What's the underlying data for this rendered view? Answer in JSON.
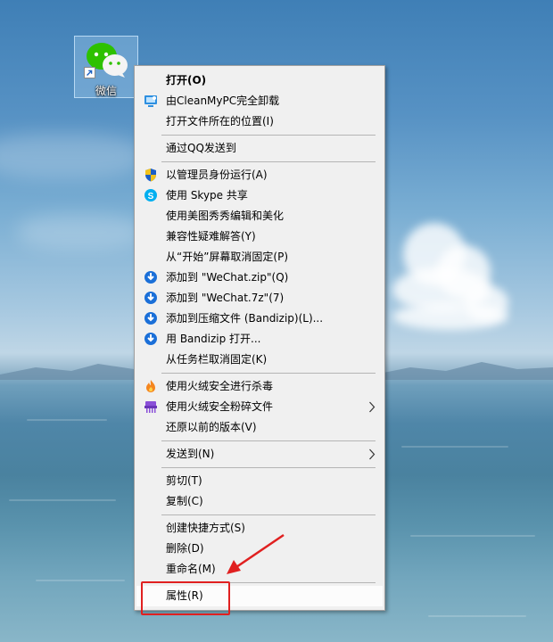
{
  "desktop": {
    "icon": {
      "label": "微信",
      "icon_name": "wechat-icon"
    }
  },
  "menu": {
    "items": [
      {
        "label": "打开(O)",
        "icon": "",
        "bold": true
      },
      {
        "label": "由CleanMyPC完全卸载",
        "icon": "cleanmypc-icon"
      },
      {
        "label": "打开文件所在的位置(I)",
        "icon": ""
      },
      {
        "label": "通过QQ发送到",
        "icon": ""
      },
      {
        "label": "以管理员身份运行(A)",
        "icon": "uac-shield-icon"
      },
      {
        "label": "使用 Skype 共享",
        "icon": "skype-icon"
      },
      {
        "label": "使用美图秀秀编辑和美化",
        "icon": ""
      },
      {
        "label": "兼容性疑难解答(Y)",
        "icon": ""
      },
      {
        "label": "从“开始”屏幕取消固定(P)",
        "icon": ""
      },
      {
        "label": "添加到 \"WeChat.zip\"(Q)",
        "icon": "bandizip-icon"
      },
      {
        "label": "添加到 \"WeChat.7z\"(7)",
        "icon": "bandizip-icon"
      },
      {
        "label": "添加到压缩文件 (Bandizip)(L)...",
        "icon": "bandizip-icon"
      },
      {
        "label": "用 Bandizip 打开...",
        "icon": "bandizip-icon"
      },
      {
        "label": "从任务栏取消固定(K)",
        "icon": ""
      },
      {
        "label": "使用火绒安全进行杀毒",
        "icon": "huorong-flame-icon"
      },
      {
        "label": "使用火绒安全粉碎文件",
        "icon": "huorong-shredder-icon",
        "submenu": true
      },
      {
        "label": "还原以前的版本(V)",
        "icon": ""
      },
      {
        "label": "发送到(N)",
        "icon": "",
        "submenu": true
      },
      {
        "label": "剪切(T)",
        "icon": ""
      },
      {
        "label": "复制(C)",
        "icon": ""
      },
      {
        "label": "创建快捷方式(S)",
        "icon": ""
      },
      {
        "label": "删除(D)",
        "icon": ""
      },
      {
        "label": "重命名(M)",
        "icon": ""
      },
      {
        "label": "属性(R)",
        "icon": "",
        "highlighted": true
      }
    ]
  },
  "colors": {
    "menu_background": "#f0f0f0",
    "menu_border": "#a0a0a0",
    "separator": "#b5b5b5",
    "annotation": "#e02020",
    "wechat_green": "#2dc100",
    "bandizip_blue": "#1a6fd8",
    "skype_blue": "#00aff0"
  }
}
